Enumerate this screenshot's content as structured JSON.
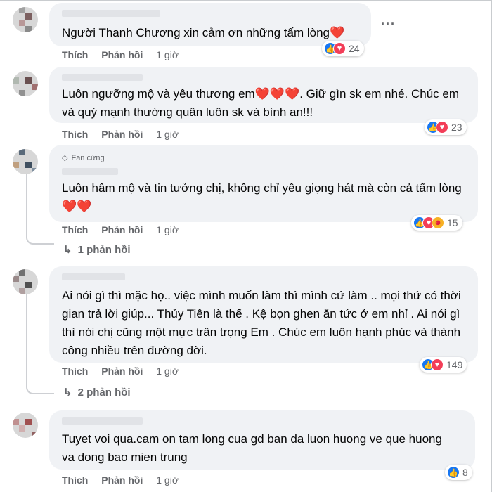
{
  "comments": [
    {
      "text": "Người Thanh Chương xin cảm ơn những tấm lòng❤️",
      "like_label": "Thích",
      "reply_label": "Phản hồi",
      "time": "1 giờ",
      "reaction_count": "24",
      "reactions": [
        "like",
        "love"
      ]
    },
    {
      "text": "Luôn ngưỡng mộ và yêu thương em❤️❤️❤️. Giữ gìn sk em nhé. Chúc em và quý mạnh thường quân luôn sk và bình an!!!",
      "like_label": "Thích",
      "reply_label": "Phản hồi",
      "time": "1 giờ",
      "reaction_count": "23",
      "reactions": [
        "like",
        "love"
      ]
    },
    {
      "badge": "Fan cứng",
      "text": "Luôn hâm mộ và tin tưởng chị, không chỉ yêu giọng hát mà còn cả tấm lòng ❤️❤️",
      "like_label": "Thích",
      "reply_label": "Phản hồi",
      "time": "1 giờ",
      "reaction_count": "15",
      "reactions": [
        "like",
        "love",
        "care"
      ],
      "replies": "1 phản hồi"
    },
    {
      "text": "Ai nói gì thì mặc họ.. việc mình muốn làm thì mình cứ làm .. mọi thứ có thời gian trả lời giúp... Thủy Tiên là thế . Kệ bọn ghen ăn tức ở em nhỉ . Ai nói gì thì nói chị cũng một mực trân trọng Em . Chúc em luôn hạnh phúc và thành công nhiều trên đường đời.",
      "like_label": "Thích",
      "reply_label": "Phản hồi",
      "time": "1 giờ",
      "reaction_count": "149",
      "reactions": [
        "like",
        "love"
      ],
      "replies": "2 phản hồi"
    },
    {
      "text": "Tuyet voi qua.cam on tam long cua gd ban da luon huong ve que huong va dong bao mien trung",
      "like_label": "Thích",
      "reply_label": "Phản hồi",
      "time": "1 giờ",
      "reaction_count": "8",
      "reactions": [
        "like"
      ]
    }
  ],
  "icons": {
    "more": "more-options-icon",
    "reply_arrow": "reply-arrow-icon",
    "badge": "diamond-icon"
  },
  "colors": {
    "like": "#1877f2",
    "love": "#f33e58",
    "bubble": "#f0f2f5",
    "meta": "#65676b"
  }
}
